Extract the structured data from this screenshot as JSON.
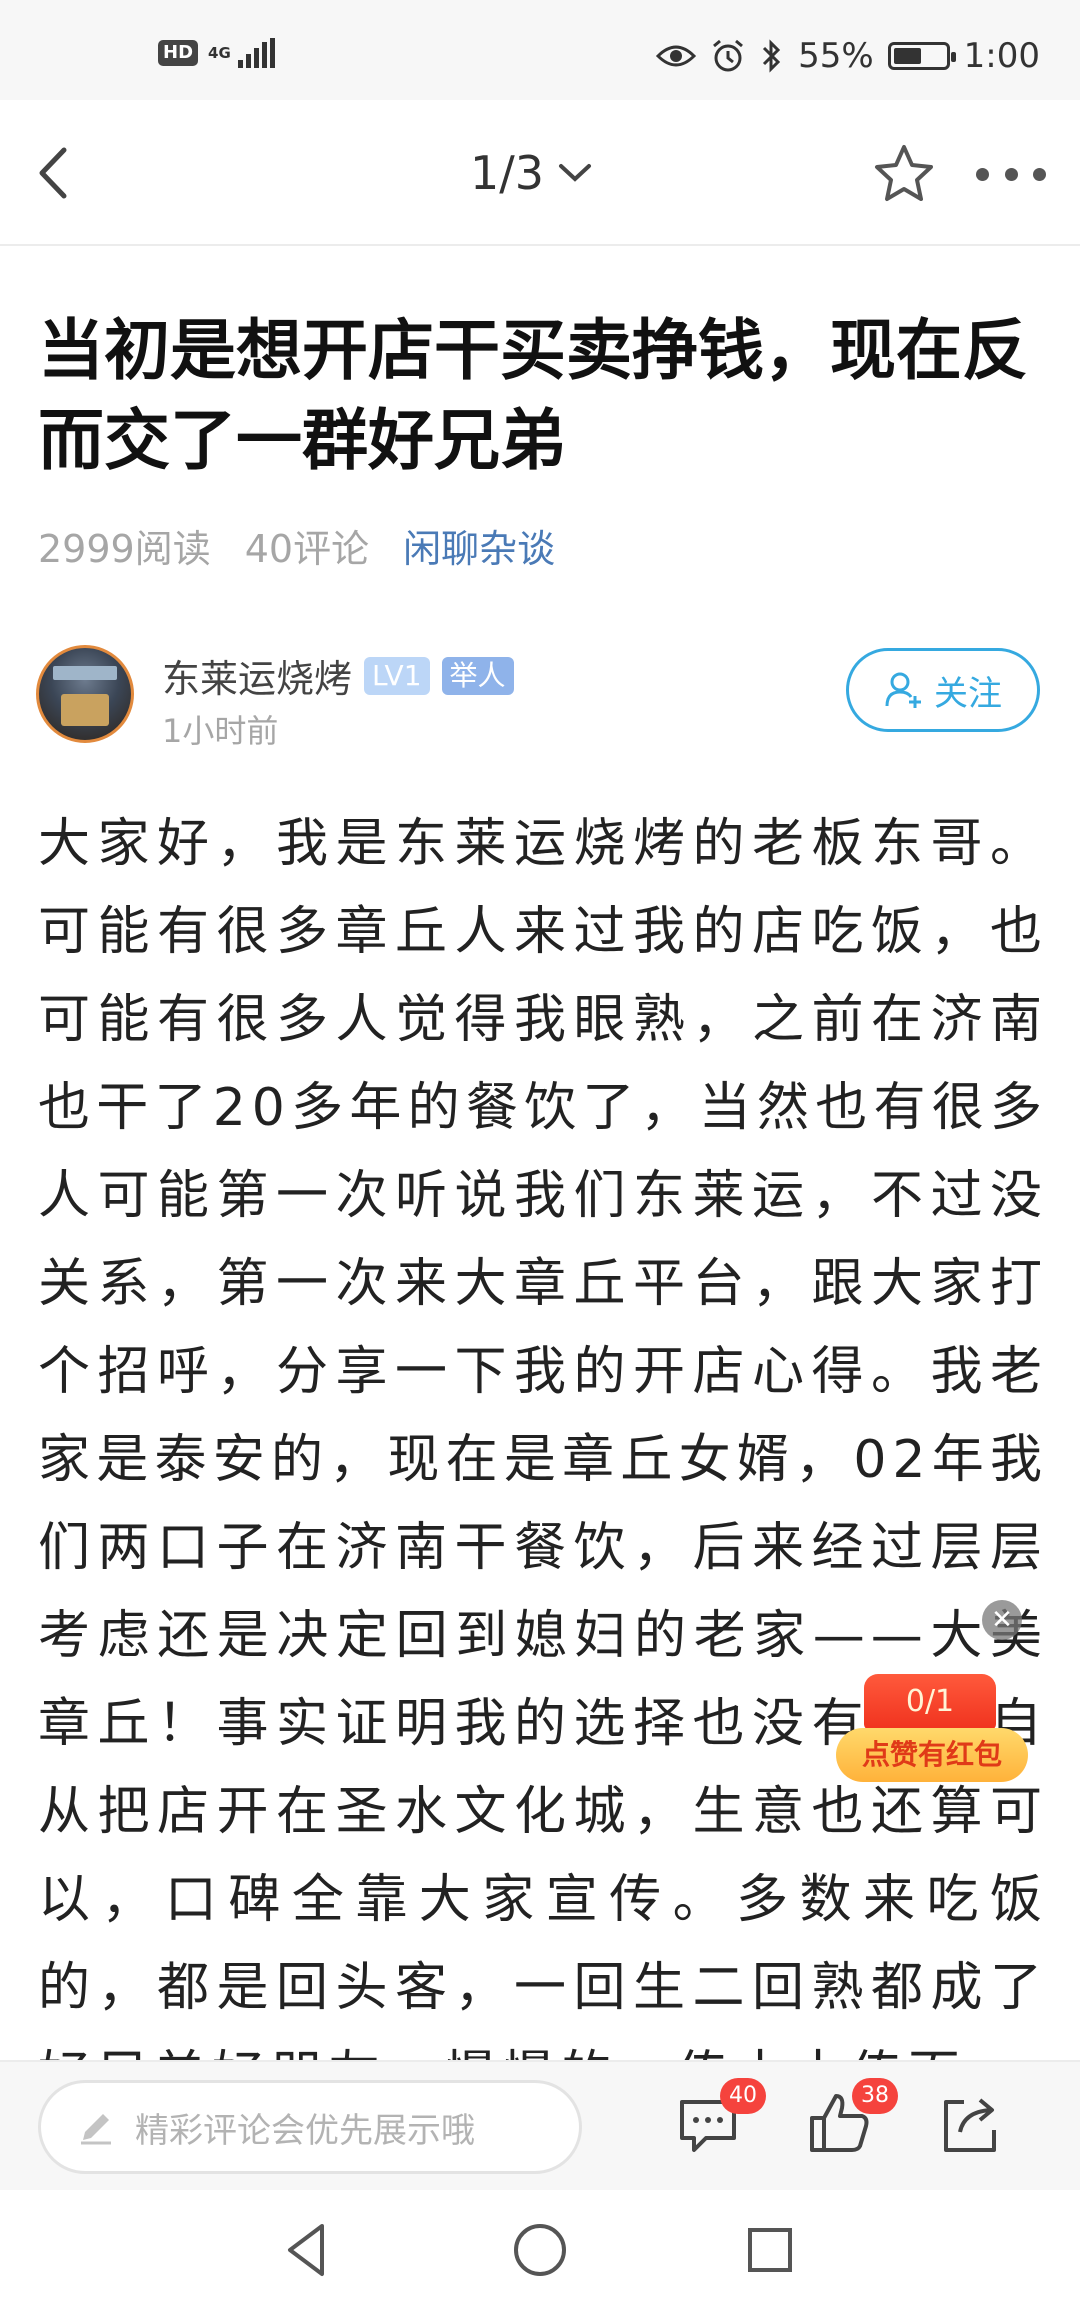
{
  "status_bar": {
    "hd": "HD",
    "network": "4G",
    "battery_percent": "55%",
    "time": "1:00"
  },
  "header": {
    "page_indicator": "1/3",
    "icons": [
      "back-arrow-icon",
      "chevron-down-icon",
      "star-icon",
      "more-icon"
    ]
  },
  "article": {
    "title": "当初是想开店干买卖挣钱，现在反而交了一群好兄弟",
    "reads": "2999阅读",
    "comments": "40评论",
    "category": "闲聊杂谈",
    "body": "大家好，我是东莱运烧烤的老板东哥。可能有很多章丘人来过我的店吃饭，也可能有很多人觉得我眼熟，之前在济南也干了20多年的餐饮了，当然也有很多人可能第一次听说我们东莱运，不过没关系，第一次来大章丘平台，跟大家打个招呼，分享一下我的开店心得。我老家是泰安的，现在是章丘女婿，02年我们两口子在济南干餐饮，后来经过层层考虑还是决定回到媳妇的老家——大美章丘！事实证明我的选择也没有错，自从把店开在圣水文化城，生意也还算可以，口碑全靠大家宣传。多数来吃饭的，都是回头客，一回生二回熟都成了好兄弟好朋友，慢慢的一传十十传百"
  },
  "author": {
    "name": "东莱运烧烤",
    "level": "LV1",
    "role": "举人",
    "time": "1小时前",
    "follow_label": "关注"
  },
  "red_packet": {
    "count": "0/1",
    "label": "点赞有红包"
  },
  "bottom_bar": {
    "comment_placeholder": "精彩评论会优先展示哦",
    "comment_count": "40",
    "like_count": "38"
  },
  "colors": {
    "accent_blue": "#35a9e0",
    "category_blue": "#4a7ab6",
    "badge_red": "#f5433d"
  }
}
